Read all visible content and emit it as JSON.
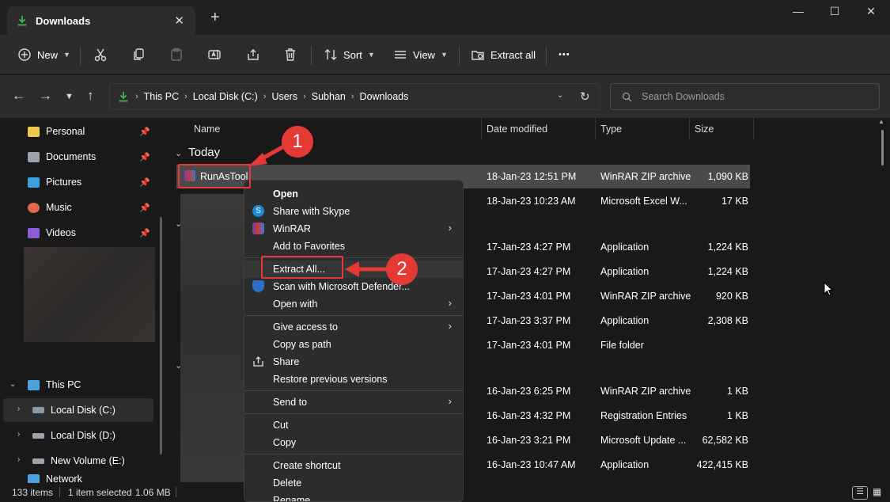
{
  "window": {
    "tab_title": "Downloads",
    "tab_close": "✕",
    "new_tab": "+",
    "minimize": "—",
    "maximize": "☐",
    "close": "✕"
  },
  "toolbar": {
    "new_label": "New",
    "sort_label": "Sort",
    "view_label": "View",
    "extract_all_label": "Extract all",
    "more_label": "•••"
  },
  "address": {
    "crumbs": [
      "This PC",
      "Local Disk (C:)",
      "Users",
      "Subhan",
      "Downloads"
    ],
    "search_placeholder": "Search Downloads"
  },
  "sidebar": {
    "pinned": [
      {
        "label": "Personal",
        "icon": "folder-icon",
        "color": "#f2c94c"
      },
      {
        "label": "Documents",
        "icon": "documents-icon",
        "color": "#9aa3ad"
      },
      {
        "label": "Pictures",
        "icon": "pictures-icon",
        "color": "#3aa0e0"
      },
      {
        "label": "Music",
        "icon": "music-icon",
        "color": "#e0684b"
      },
      {
        "label": "Videos",
        "icon": "videos-icon",
        "color": "#8a5cd6"
      }
    ],
    "tree": [
      {
        "label": "This PC",
        "icon": "pc-icon"
      },
      {
        "label": "Local Disk (C:)",
        "icon": "drive-icon"
      },
      {
        "label": "Local Disk (D:)",
        "icon": "drive-icon"
      },
      {
        "label": "New Volume (E:)",
        "icon": "drive-icon"
      },
      {
        "label": "Network",
        "icon": "network-icon"
      }
    ]
  },
  "columns": {
    "name": "Name",
    "date": "Date modified",
    "type": "Type",
    "size": "Size"
  },
  "group_today": "Today",
  "rows": [
    {
      "name": "RunAsTool",
      "date": "18-Jan-23 12:51 PM",
      "type": "WinRAR ZIP archive",
      "size": "1,090 KB"
    },
    {
      "name": "",
      "date": "18-Jan-23 10:23 AM",
      "type": "Microsoft Excel W...",
      "size": "17 KB"
    },
    {
      "name": "",
      "date": "17-Jan-23 4:27 PM",
      "type": "Application",
      "size": "1,224 KB"
    },
    {
      "name": "",
      "date": "17-Jan-23 4:27 PM",
      "type": "Application",
      "size": "1,224 KB"
    },
    {
      "name": "",
      "date": "17-Jan-23 4:01 PM",
      "type": "WinRAR ZIP archive",
      "size": "920 KB"
    },
    {
      "name": "",
      "date": "17-Jan-23 3:37 PM",
      "type": "Application",
      "size": "2,308 KB"
    },
    {
      "name": "",
      "date": "17-Jan-23 4:01 PM",
      "type": "File folder",
      "size": ""
    },
    {
      "name": "",
      "date": "16-Jan-23 6:25 PM",
      "type": "WinRAR ZIP archive",
      "size": "1 KB"
    },
    {
      "name": "",
      "date": "16-Jan-23 4:32 PM",
      "type": "Registration Entries",
      "size": "1 KB"
    },
    {
      "name": "",
      "date": "16-Jan-23 3:21 PM",
      "type": "Microsoft Update ...",
      "size": "62,582 KB"
    },
    {
      "name": "",
      "date": "16-Jan-23 10:47 AM",
      "type": "Application",
      "size": "422,415 KB"
    }
  ],
  "status": {
    "items": "133 items",
    "selected": "1 item selected",
    "size": "1.06 MB"
  },
  "context_menu": {
    "open": "Open",
    "share_skype": "Share with Skype",
    "winrar": "WinRAR",
    "add_favorites": "Add to Favorites",
    "extract_all": "Extract All...",
    "scan_defender": "Scan with Microsoft Defender...",
    "open_with": "Open with",
    "give_access": "Give access to",
    "copy_path": "Copy as path",
    "share": "Share",
    "restore": "Restore previous versions",
    "send_to": "Send to",
    "cut": "Cut",
    "copy": "Copy",
    "create_shortcut": "Create shortcut",
    "delete": "Delete",
    "rename": "Rename",
    "submenu_glyph": "›"
  },
  "annotations": {
    "badge_1": "1",
    "badge_2": "2",
    "color": "#e53935"
  }
}
